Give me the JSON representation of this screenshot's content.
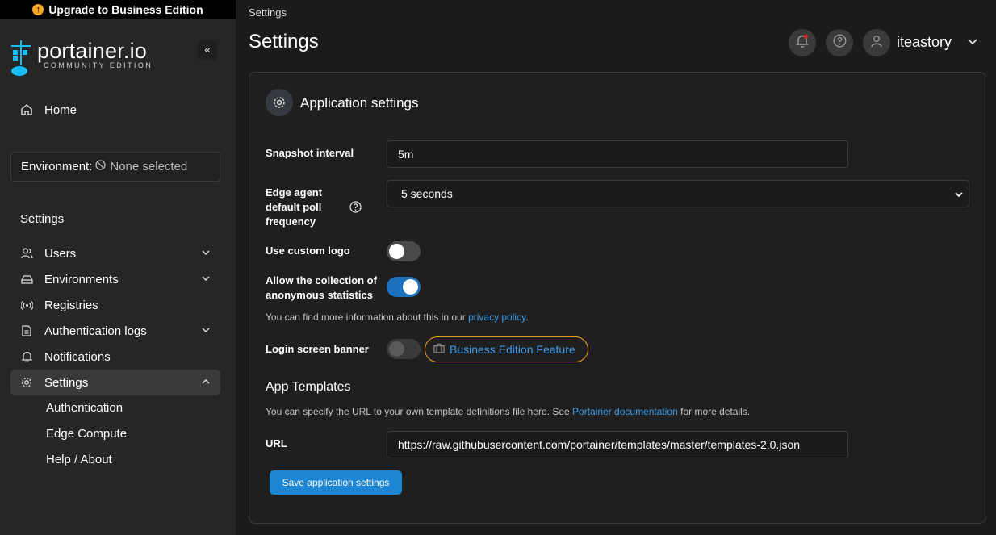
{
  "upgrade_banner": "Upgrade to Business Edition",
  "logo": {
    "main": "portainer.io",
    "sub": "COMMUNITY EDITION"
  },
  "sidebar": {
    "collapse_label": "«",
    "home": "Home",
    "environment_label": "Environment:",
    "environment_value": "None selected",
    "section": "Settings",
    "items": [
      {
        "label": "Users",
        "icon": "users-icon",
        "has_chevron": true
      },
      {
        "label": "Environments",
        "icon": "drive-icon",
        "has_chevron": true
      },
      {
        "label": "Registries",
        "icon": "radio-icon",
        "has_chevron": false
      },
      {
        "label": "Authentication logs",
        "icon": "file-icon",
        "has_chevron": true
      },
      {
        "label": "Notifications",
        "icon": "bell-icon",
        "has_chevron": false
      },
      {
        "label": "Settings",
        "icon": "gear-icon",
        "has_chevron": true,
        "active": true
      }
    ],
    "sub_items": [
      "Authentication",
      "Edge Compute",
      "Help / About"
    ]
  },
  "header": {
    "breadcrumb": "Settings",
    "title": "Settings",
    "username": "iteastory"
  },
  "card": {
    "title": "Application settings",
    "snapshot_label": "Snapshot interval",
    "snapshot_value": "5m",
    "edge_label": "Edge agent default poll frequency",
    "edge_value": "5 seconds",
    "logo_label": "Use custom logo",
    "stats_label": "Allow the collection of anonymous statistics",
    "stats_help_prefix": "You can find more information about this in our",
    "stats_help_link": "privacy policy",
    "stats_help_suffix": ".",
    "banner_label": "Login screen banner",
    "be_feature": "Business Edition Feature",
    "templates_heading": "App Templates",
    "templates_help_prefix": "You can specify the URL to your own template definitions file here. See",
    "templates_help_link": "Portainer documentation",
    "templates_help_suffix": "for more details.",
    "url_label": "URL",
    "url_value": "https://raw.githubusercontent.com/portainer/templates/master/templates-2.0.json",
    "save_label": "Save application settings",
    "toggles": {
      "custom_logo": false,
      "anonymous_stats": true,
      "login_banner": false
    }
  },
  "colors": {
    "accent": "#1c72bf",
    "link": "#3b9bea",
    "badge_border": "#f0a020",
    "upgrade_icon": "#f5a623"
  }
}
